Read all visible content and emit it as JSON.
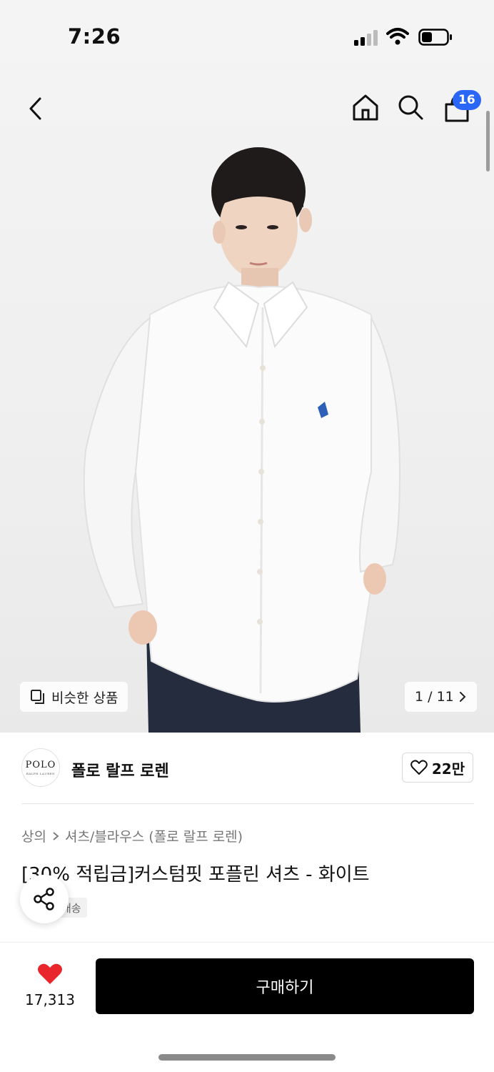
{
  "status_bar": {
    "time": "7:26"
  },
  "header": {
    "cart_badge_count": "16",
    "icons": [
      "back-icon",
      "home-icon",
      "search-icon",
      "cart-icon"
    ]
  },
  "gallery": {
    "similar_products_label": "비슷한 상품",
    "page_indicator": "1 / 11",
    "current_image": 1,
    "total_images": 11
  },
  "brand": {
    "logo_text": "POLO",
    "logo_subtext": "RALPH LAUREN",
    "name": "폴로 랄프 로렌",
    "like_count": "22만"
  },
  "product": {
    "breadcrumb": [
      "상의",
      "셔츠/블라우스 (폴로 랄프 로렌)"
    ],
    "title": "[30% 적립금]커스텀핏 포플린 셔츠 - 화이트",
    "shipping_tag": "배송"
  },
  "bottom_bar": {
    "wish_count": "17,313",
    "buy_label": "구매하기"
  },
  "colors": {
    "badge_blue": "#2b67f6",
    "heart_red": "#e8262b",
    "buy_button_bg": "#000000"
  }
}
